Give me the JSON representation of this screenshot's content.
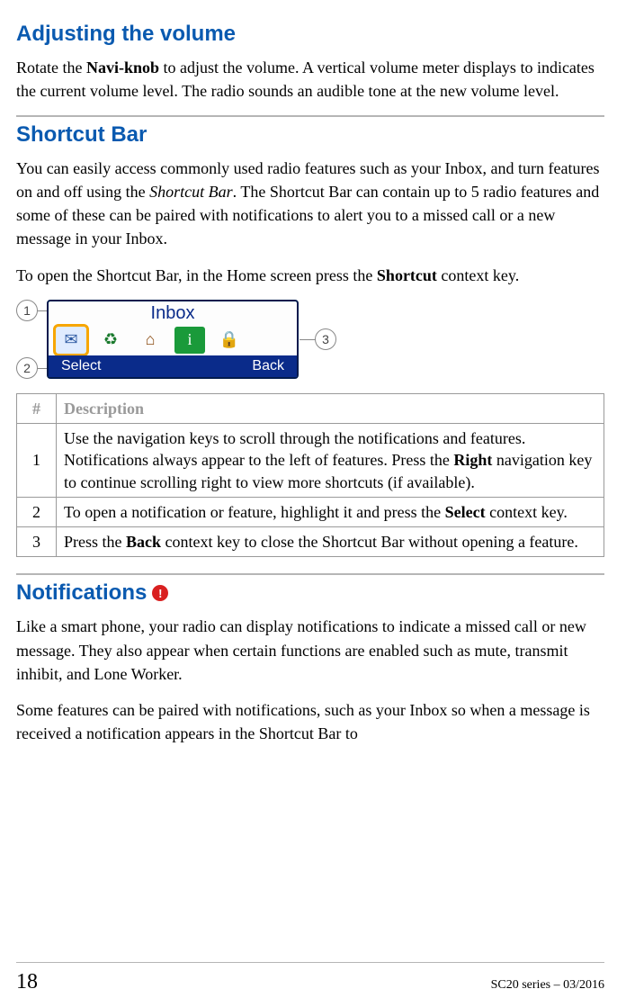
{
  "sections": {
    "volume": {
      "heading": "Adjusting the volume",
      "para_pre": "Rotate the ",
      "para_bold": "Navi-knob",
      "para_post": " to adjust the volume. A vertical volume meter displays to indicates the current volume level. The radio sounds an audible tone at the new volume level."
    },
    "shortcut": {
      "heading": "Shortcut Bar",
      "p1_pre": "You can easily access commonly used radio features such as your Inbox, and turn features on and off using the ",
      "p1_ital": "Shortcut Bar",
      "p1_post": ". The Shortcut Bar can contain up to 5 radio features and some of these can be paired with notifications to alert you to a missed call or a new message in your Inbox.",
      "p2_pre": "To open the Shortcut Bar, in the Home screen press the ",
      "p2_bold": "Shortcut",
      "p2_post": " context key."
    },
    "illus": {
      "title": "Inbox",
      "select": "Select",
      "back": "Back",
      "c1": "1",
      "c2": "2",
      "c3": "3"
    },
    "table": {
      "h_num": "#",
      "h_desc": "Description",
      "rows": [
        {
          "n": "1",
          "pre": "Use the navigation keys to scroll through the notifications and features. Notifications always appear to the left of features. Press the ",
          "bold": "Right",
          "post": " navigation key to continue scrolling right to view more shortcuts (if available)."
        },
        {
          "n": "2",
          "pre": "To open a notification or feature, highlight it and press the ",
          "bold": "Select",
          "post": " context key."
        },
        {
          "n": "3",
          "pre": "Press the ",
          "bold": "Back",
          "post": " context key to close the Shortcut Bar without opening a feature."
        }
      ]
    },
    "notif": {
      "heading": "Notifications",
      "alert": "!",
      "p1": "Like a smart phone, your radio can display notifications to indicate a missed call or new message. They also appear when certain functions are enabled such as mute, transmit inhibit, and Lone Worker.",
      "p2": "Some features can be paired with notifications, such as your Inbox so when a message is received a notification appears in the Shortcut Bar to"
    }
  },
  "footer": {
    "page": "18",
    "doc": "SC20 series – 03/2016"
  }
}
